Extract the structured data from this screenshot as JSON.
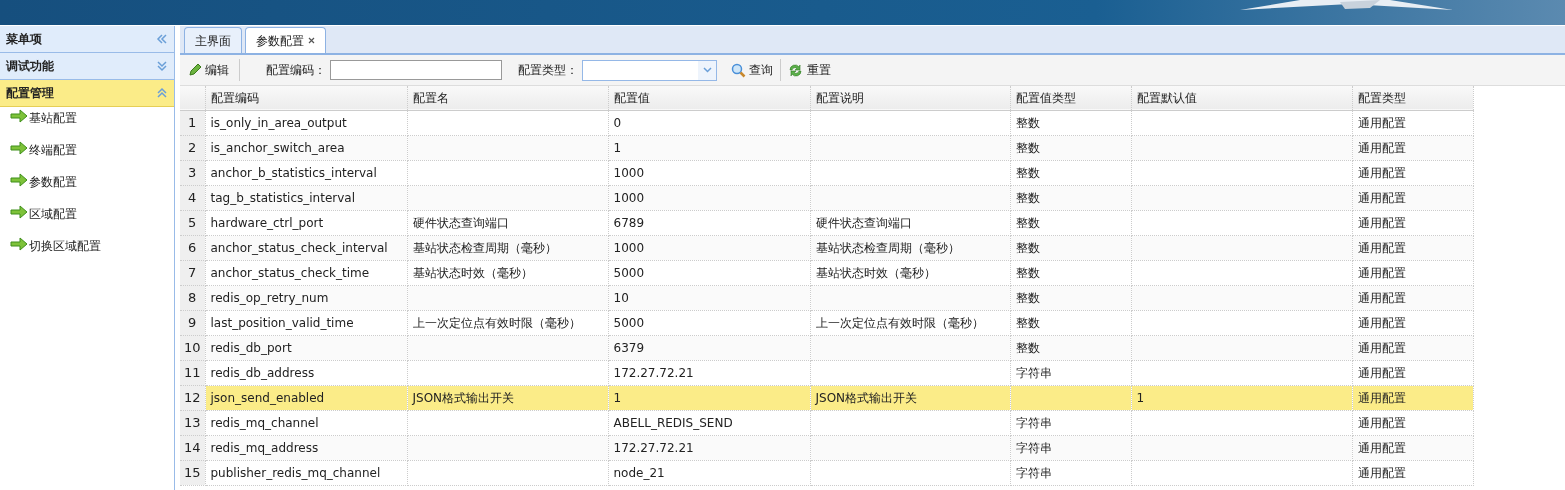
{
  "sidebar": {
    "title": "菜单项",
    "sections": [
      {
        "title": "调试功能",
        "expanded": false,
        "selected": false
      },
      {
        "title": "配置管理",
        "expanded": true,
        "selected": true,
        "items": [
          "基站配置",
          "终端配置",
          "参数配置",
          "区域配置",
          "切换区域配置"
        ]
      }
    ]
  },
  "tabs": [
    {
      "label": "主界面",
      "selected": false,
      "closable": false
    },
    {
      "label": "参数配置",
      "selected": true,
      "closable": true
    }
  ],
  "toolbar": {
    "edit": "编辑",
    "code_label": "配置编码：",
    "type_label": "配置类型：",
    "search": "查询",
    "reset": "重置"
  },
  "table": {
    "columns": [
      "配置编码",
      "配置名",
      "配置值",
      "配置说明",
      "配置值类型",
      "配置默认值",
      "配置类型"
    ],
    "rows": [
      {
        "no": "1",
        "selected": false,
        "cells": [
          "is_only_in_area_output",
          null,
          "0",
          null,
          "整数",
          null,
          "通用配置"
        ]
      },
      {
        "no": "2",
        "selected": false,
        "cells": [
          "is_anchor_switch_area",
          null,
          "1",
          null,
          "整数",
          null,
          "通用配置"
        ]
      },
      {
        "no": "3",
        "selected": false,
        "cells": [
          "anchor_b_statistics_interval",
          null,
          "1000",
          null,
          "整数",
          null,
          "通用配置"
        ]
      },
      {
        "no": "4",
        "selected": false,
        "cells": [
          "tag_b_statistics_interval",
          null,
          "1000",
          null,
          "整数",
          null,
          "通用配置"
        ]
      },
      {
        "no": "5",
        "selected": false,
        "cells": [
          "hardware_ctrl_port",
          "硬件状态查询端口",
          "6789",
          "硬件状态查询端口",
          "整数",
          null,
          "通用配置"
        ]
      },
      {
        "no": "6",
        "selected": false,
        "cells": [
          "anchor_status_check_interval",
          "基站状态检查周期（毫秒）",
          "1000",
          "基站状态检查周期（毫秒）",
          "整数",
          null,
          "通用配置"
        ]
      },
      {
        "no": "7",
        "selected": false,
        "cells": [
          "anchor_status_check_time",
          "基站状态时效（毫秒）",
          "5000",
          "基站状态时效（毫秒）",
          "整数",
          null,
          "通用配置"
        ]
      },
      {
        "no": "8",
        "selected": false,
        "cells": [
          "redis_op_retry_num",
          null,
          "10",
          null,
          "整数",
          null,
          "通用配置"
        ]
      },
      {
        "no": "9",
        "selected": false,
        "cells": [
          "last_position_valid_time",
          "上一次定位点有效时限（毫秒）",
          "5000",
          "上一次定位点有效时限（毫秒）",
          "整数",
          null,
          "通用配置"
        ]
      },
      {
        "no": "10",
        "selected": false,
        "cells": [
          "redis_db_port",
          null,
          "6379",
          null,
          "整数",
          null,
          "通用配置"
        ]
      },
      {
        "no": "11",
        "selected": false,
        "cells": [
          "redis_db_address",
          null,
          "172.27.72.21",
          null,
          "字符串",
          null,
          "通用配置"
        ]
      },
      {
        "no": "12",
        "selected": true,
        "cells": [
          "json_send_enabled",
          "JSON格式输出开关",
          "1",
          "JSON格式输出开关",
          null,
          "1",
          "通用配置"
        ]
      },
      {
        "no": "13",
        "selected": false,
        "cells": [
          "redis_mq_channel",
          null,
          "ABELL_REDIS_SEND",
          null,
          "字符串",
          null,
          "通用配置"
        ]
      },
      {
        "no": "14",
        "selected": false,
        "cells": [
          "redis_mq_address",
          null,
          "172.27.72.21",
          null,
          "字符串",
          null,
          "通用配置"
        ]
      },
      {
        "no": "15",
        "selected": false,
        "cells": [
          "publisher_redis_mq_channel",
          null,
          "node_21",
          null,
          "字符串",
          null,
          "通用配置"
        ]
      }
    ]
  }
}
